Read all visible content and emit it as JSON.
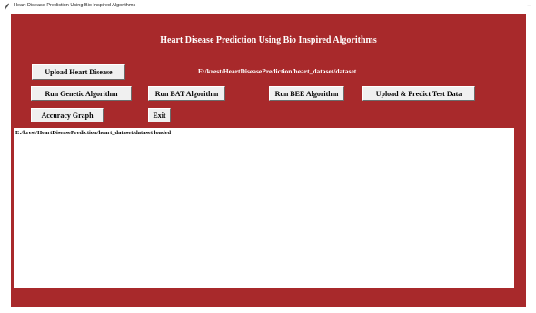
{
  "window": {
    "title": "Heart Disease Prediction Using Bio Inspired Algorithms",
    "minimize_symbol": "–"
  },
  "main": {
    "heading": "Heart Disease Prediction Using Bio Inspired Algorithms",
    "path_label": "E:/krest/HeartDiseasePrediction/heart_dataset/dataset",
    "output_text": "E:/krest/HeartDiseasePrediction/heart_dataset/dataset loaded"
  },
  "buttons": {
    "upload_label": "Upload Heart Disease",
    "genetic_label": "Run Genetic Algorithm",
    "bat_label": "Run BAT Algorithm",
    "bee_label": "Run BEE Algorithm",
    "predict_label": "Upload & Predict Test Data",
    "accuracy_label": "Accuracy Graph",
    "exit_label": "Exit"
  },
  "colors": {
    "background": "#a8292b",
    "button_face": "#f0f0f0",
    "text_light": "#ffffff"
  },
  "icons": {
    "app": "feather-icon"
  }
}
